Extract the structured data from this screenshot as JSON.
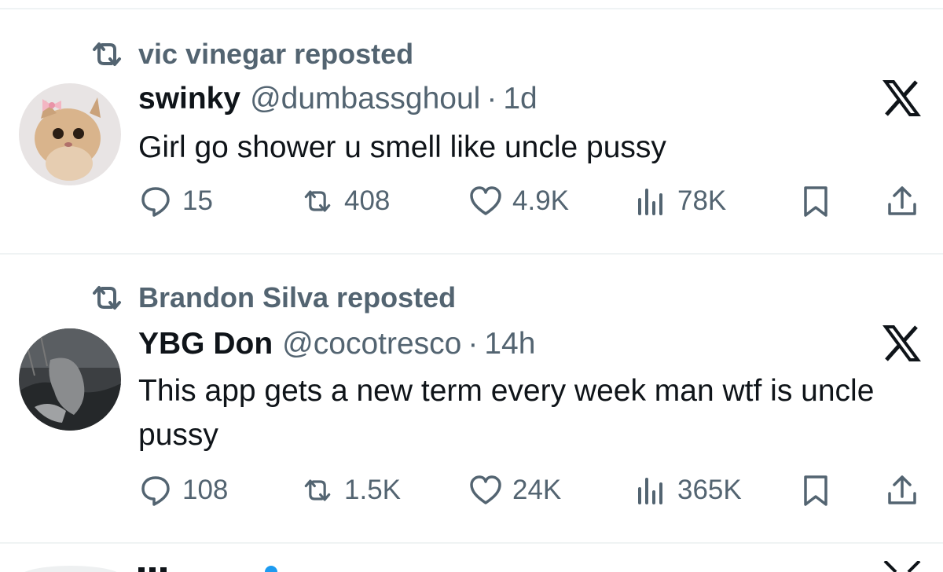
{
  "posts": [
    {
      "repost_label": "vic vinegar reposted",
      "name": "swinky",
      "handle": "@dumbassghoul",
      "separator": "·",
      "time": "1d",
      "text": "Girl go shower u smell like uncle pussy",
      "replies": "15",
      "reposts": "408",
      "likes": "4.9K",
      "views": "78K"
    },
    {
      "repost_label": "Brandon Silva reposted",
      "name": "YBG Don",
      "handle": "@cocotresco",
      "separator": "·",
      "time": "14h",
      "text": "This app gets a new term every week man wtf is uncle pussy",
      "replies": "108",
      "reposts": "1.5K",
      "likes": "24K",
      "views": "365K"
    }
  ],
  "colors": {
    "text_primary": "#0f1419",
    "text_secondary": "#536471",
    "divider": "#eff3f4"
  },
  "icons": [
    "repost-icon",
    "x-logo-icon",
    "reply-icon",
    "like-icon",
    "views-icon",
    "bookmark-icon",
    "share-icon"
  ]
}
